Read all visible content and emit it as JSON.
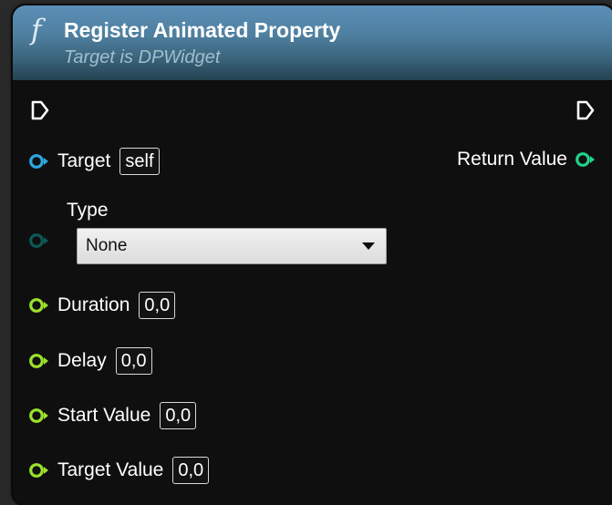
{
  "node": {
    "title": "Register Animated Property",
    "subtitle": "Target is DPWidget",
    "function_icon": "function-f-icon",
    "header_color": "#4f7f9f"
  },
  "pins": {
    "target": {
      "label": "Target",
      "value": "self",
      "color": "#2ea7e0"
    },
    "type": {
      "label": "Type",
      "value": "None",
      "color": "#0b5a55"
    },
    "duration": {
      "label": "Duration",
      "value": "0,0",
      "color": "#9be22b"
    },
    "delay": {
      "label": "Delay",
      "value": "0,0",
      "color": "#9be22b"
    },
    "start_value": {
      "label": "Start Value",
      "value": "0,0",
      "color": "#9be22b"
    },
    "target_value": {
      "label": "Target Value",
      "value": "0,0",
      "color": "#9be22b"
    },
    "return_value": {
      "label": "Return Value",
      "color": "#22d38a"
    }
  },
  "icons": {
    "exec_in": "exec-in-pin-icon",
    "exec_out": "exec-out-pin-icon",
    "dropdown": "chevron-down-icon"
  }
}
